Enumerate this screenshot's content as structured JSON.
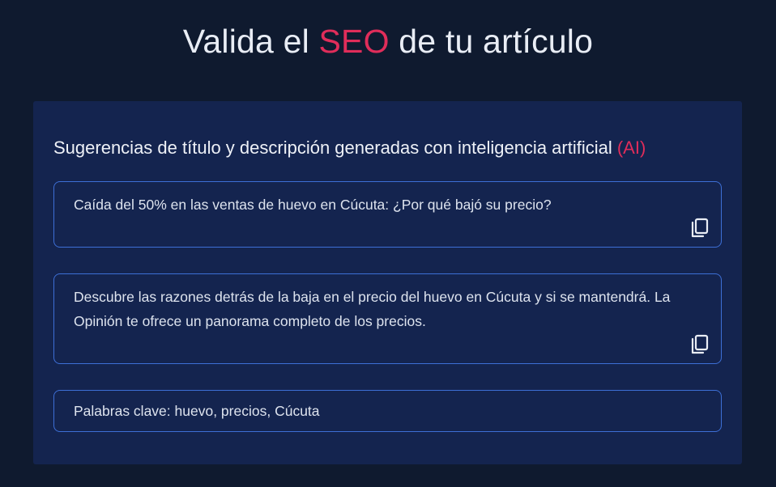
{
  "header": {
    "title_prefix": "Valida el",
    "title_accent": "SEO",
    "title_suffix": "de tu artículo"
  },
  "suggestions": {
    "heading": "Sugerencias de título y descripción generadas con inteligencia artificial",
    "heading_accent": "(AI)",
    "title_suggestion": "Caída del 50% en las ventas de huevo en Cúcuta: ¿Por qué bajó su precio?",
    "description_suggestion": "Descubre las razones detrás de la baja en el precio del huevo en Cúcuta y si se mantendrá. La Opinión te ofrece un panorama completo de los precios.",
    "keywords_label": "Palabras clave:",
    "keywords": "huevo, precios, Cúcuta",
    "copy_icon": "copy-icon"
  },
  "colors": {
    "background": "#0f1a2f",
    "card": "#14244f",
    "accent": "#e02d5a",
    "field_border": "#3d6fd6",
    "text": "#e9edf5"
  }
}
